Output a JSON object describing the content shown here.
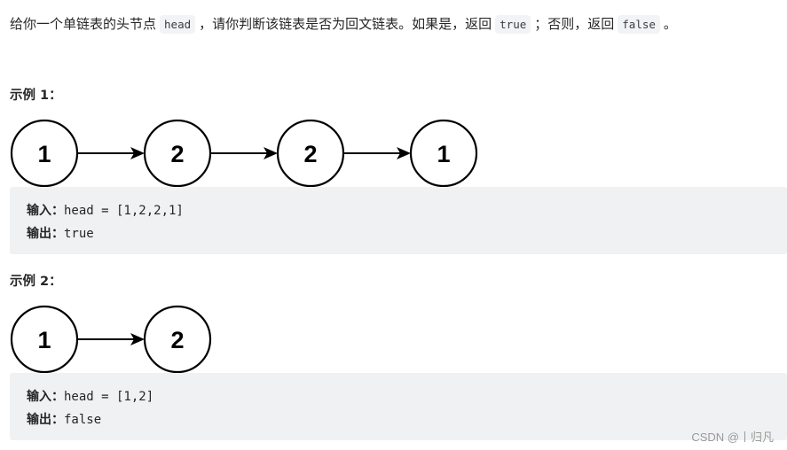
{
  "description": {
    "part1": "给你一个单链表的头节点",
    "code1": "head",
    "part2": "，请你判断该链表是否为回文链表。如果是，返回",
    "code2": "true",
    "part3": "；否则，返回",
    "code3": "false",
    "part4": "。"
  },
  "examples": [
    {
      "title": "示例 1：",
      "nodes": [
        "1",
        "2",
        "2",
        "1"
      ],
      "input_label": "输入：",
      "input_value": "head = [1,2,2,1]",
      "output_label": "输出：",
      "output_value": "true"
    },
    {
      "title": "示例 2：",
      "nodes": [
        "1",
        "2"
      ],
      "input_label": "输入：",
      "input_value": "head = [1,2]",
      "output_label": "输出：",
      "output_value": "false"
    }
  ],
  "watermark": "CSDN @丨归凡"
}
